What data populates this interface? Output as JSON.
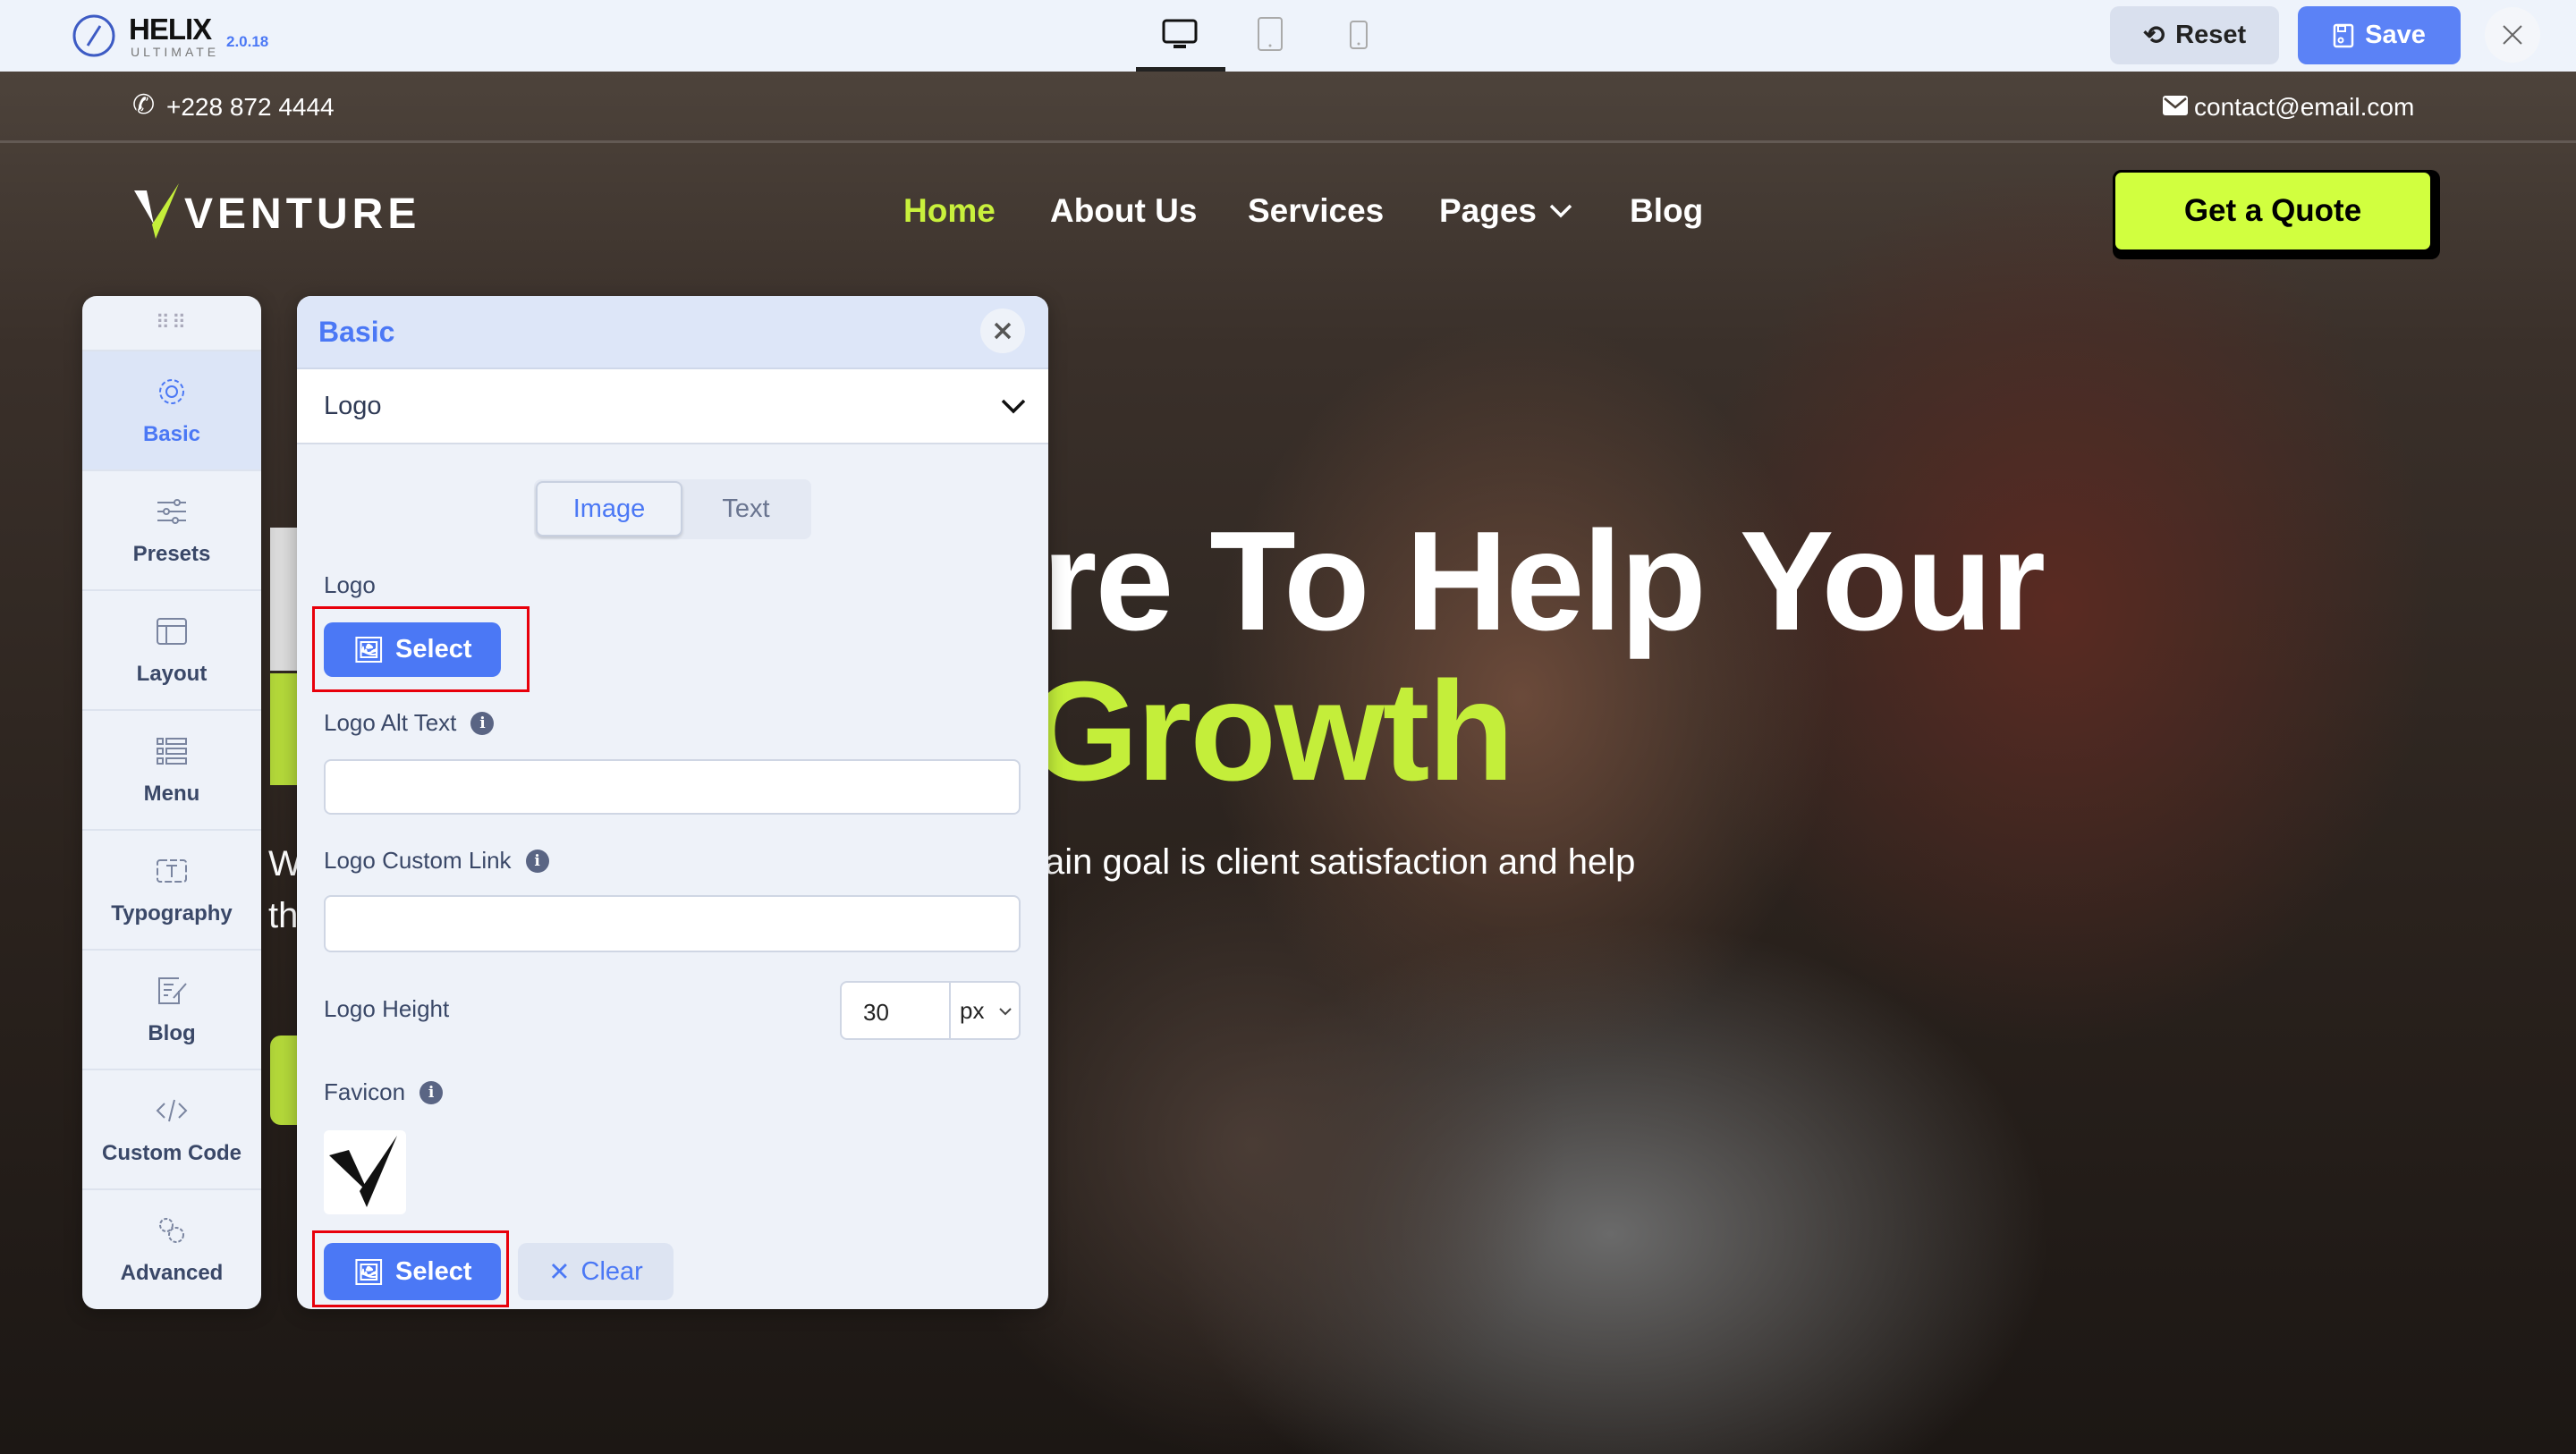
{
  "app": {
    "name": "HELIX",
    "subtitle": "ULTIMATE",
    "version": "2.0.18",
    "reset_label": "Reset",
    "save_label": "Save",
    "devices": [
      "desktop",
      "tablet",
      "mobile"
    ],
    "active_device": "desktop"
  },
  "site": {
    "phone": "+228 872 4444",
    "email": "contact@email.com",
    "logo": "VENTURE",
    "nav": [
      {
        "label": "Home",
        "active": true
      },
      {
        "label": "About Us"
      },
      {
        "label": "Services"
      },
      {
        "label": "Pages",
        "has_dropdown": true
      },
      {
        "label": "Blog"
      }
    ],
    "cta": "Get a Quote",
    "hero": {
      "line1": "re To Help Your",
      "line2": "Growth",
      "para_start": "W",
      "para": "ain goal is client satisfaction and help",
      "para2_start": "th"
    }
  },
  "sidebar": {
    "items": [
      {
        "label": "Basic",
        "icon": "gear-icon",
        "active": true
      },
      {
        "label": "Presets",
        "icon": "sliders-icon"
      },
      {
        "label": "Layout",
        "icon": "layout-icon"
      },
      {
        "label": "Menu",
        "icon": "menu-list-icon"
      },
      {
        "label": "Typography",
        "icon": "text-icon"
      },
      {
        "label": "Blog",
        "icon": "edit-icon"
      },
      {
        "label": "Custom Code",
        "icon": "code-icon"
      },
      {
        "label": "Advanced",
        "icon": "cogs-icon"
      }
    ]
  },
  "panel": {
    "title": "Basic",
    "section": "Logo",
    "toggle": {
      "options": [
        "Image",
        "Text"
      ],
      "selected": "Image"
    },
    "logo_label": "Logo",
    "select_label": "Select",
    "alt_label": "Logo Alt Text",
    "alt_value": "",
    "link_label": "Logo Custom Link",
    "link_value": "",
    "height_label": "Logo Height",
    "height_value": "30",
    "height_unit": "px",
    "favicon_label": "Favicon",
    "clear_label": "Clear"
  },
  "colors": {
    "accent": "#4b78f5",
    "brand_green": "#d1ff3f",
    "highlight": "#e8000b"
  }
}
